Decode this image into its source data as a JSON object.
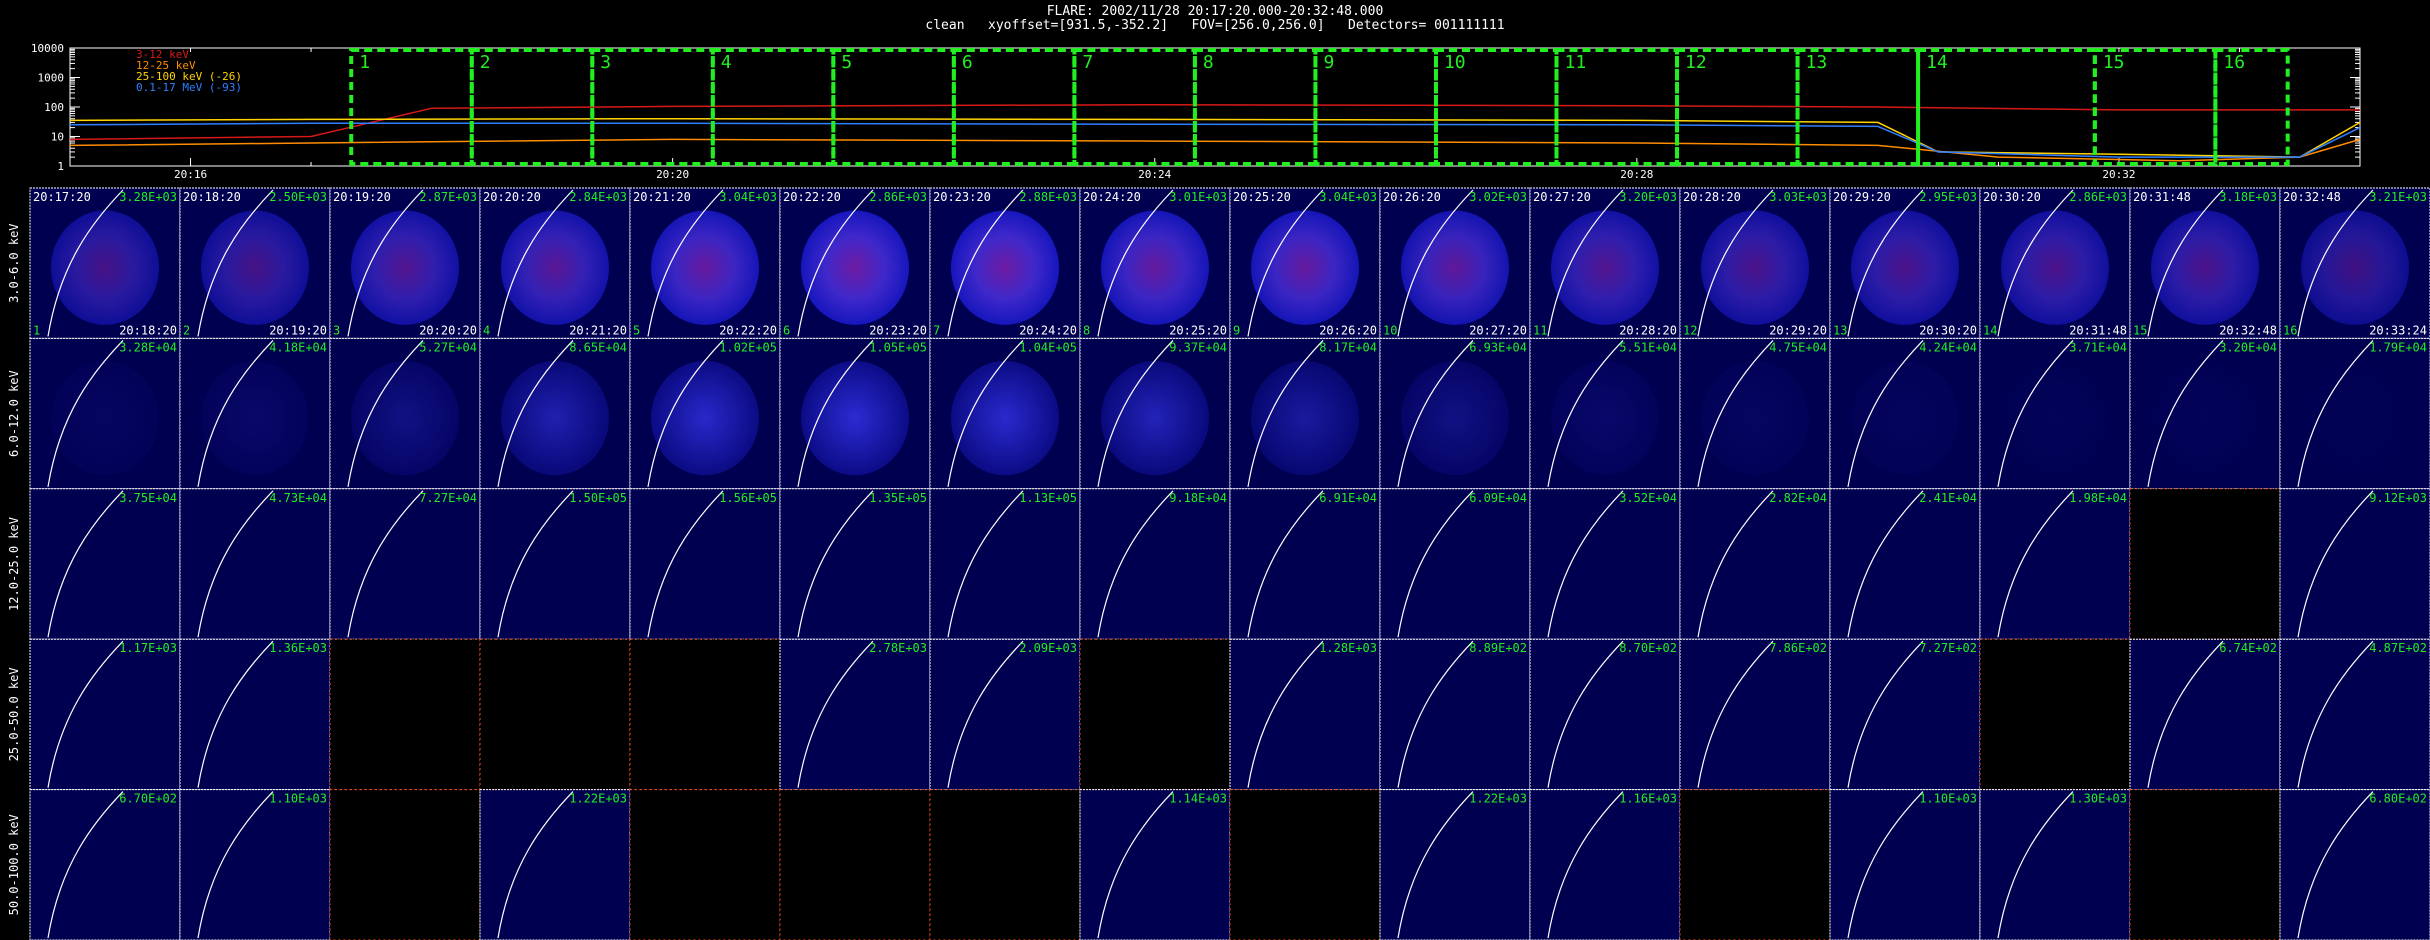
{
  "header": {
    "title": "FLARE: 2002/11/28 20:17:20.000-20:32:48.000",
    "subtitle": "clean   xyoffset=[931.5,-352.2]   FOV=[256.0,256.0]   Detectors= 001111111"
  },
  "lightcurve": {
    "legend": [
      {
        "label": "3-12 keV",
        "color": "#d81818"
      },
      {
        "label": "12-25 keV",
        "color": "#ff8c00"
      },
      {
        "label": "25-100 keV (-26)",
        "color": "#ffd400"
      },
      {
        "label": "0.1-17 MeV (-93)",
        "color": "#2f7fff"
      }
    ],
    "y_ticks": [
      "10000",
      "1000",
      "100",
      "10",
      "1"
    ],
    "x_ticks": [
      "20:16",
      "20:20",
      "20:24",
      "20:28",
      "20:32"
    ],
    "box_color": "#22ee22",
    "interval_boxes": [
      {
        "id": "1"
      },
      {
        "id": "2"
      },
      {
        "id": "3"
      },
      {
        "id": "4"
      },
      {
        "id": "5"
      },
      {
        "id": "6"
      },
      {
        "id": "7"
      },
      {
        "id": "8"
      },
      {
        "id": "9"
      },
      {
        "id": "10"
      },
      {
        "id": "11"
      },
      {
        "id": "12"
      },
      {
        "id": "13"
      },
      {
        "id": "14"
      },
      {
        "id": "15"
      },
      {
        "id": "16"
      }
    ],
    "chart_data": {
      "type": "line",
      "x_time_range": [
        "20:15:00",
        "20:34:00"
      ],
      "y_scale": "log",
      "y_range": [
        1,
        10000
      ],
      "series": [
        {
          "name": "3-12 keV",
          "t": [
            "20:15:00",
            "20:17:00",
            "20:18:00",
            "20:20:00",
            "20:24:00",
            "20:28:00",
            "20:30:00",
            "20:32:00",
            "20:34:00"
          ],
          "y": [
            8,
            10,
            90,
            105,
            120,
            110,
            100,
            80,
            80
          ]
        },
        {
          "name": "12-25 keV",
          "t": [
            "20:15:00",
            "20:17:00",
            "20:20:00",
            "20:24:00",
            "20:28:00",
            "20:30:00",
            "20:31:00",
            "20:32:30",
            "20:33:30",
            "20:34:00"
          ],
          "y": [
            5,
            6,
            8,
            7,
            6,
            5,
            2,
            1.5,
            2,
            8
          ]
        },
        {
          "name": "25-100 keV (-26)",
          "t": [
            "20:15:00",
            "20:17:00",
            "20:20:00",
            "20:24:00",
            "20:28:00",
            "20:30:00",
            "20:30:30",
            "20:32:00",
            "20:33:30",
            "20:34:00"
          ],
          "y": [
            35,
            38,
            40,
            38,
            35,
            30,
            3,
            2.5,
            2,
            30
          ]
        },
        {
          "name": "0.1-17 MeV (-93)",
          "t": [
            "20:15:00",
            "20:17:00",
            "20:20:00",
            "20:24:00",
            "20:28:00",
            "20:30:00",
            "20:30:30",
            "20:32:00",
            "20:33:30",
            "20:34:00"
          ],
          "y": [
            25,
            28,
            28,
            26,
            25,
            22,
            3,
            2,
            2,
            20
          ]
        }
      ]
    }
  },
  "image_grid": {
    "label_color": "#22ee22",
    "rows": [
      {
        "label": "3.0-6.0 keV",
        "fluxes": [
          "3.28E+03",
          "2.50E+03",
          "2.87E+03",
          "2.84E+03",
          "3.04E+03",
          "2.86E+03",
          "2.88E+03",
          "3.01E+03",
          "3.04E+03",
          "3.02E+03",
          "3.20E+03",
          "3.03E+03",
          "2.95E+03",
          "2.86E+03",
          "3.18E+03",
          "3.21E+03"
        ],
        "empty": [],
        "intensity": [
          0.55,
          0.55,
          0.65,
          0.7,
          0.8,
          0.85,
          0.85,
          0.8,
          0.8,
          0.75,
          0.65,
          0.6,
          0.6,
          0.6,
          0.6,
          0.5
        ]
      },
      {
        "label": "6.0-12.0 keV",
        "fluxes": [
          "3.28E+04",
          "4.18E+04",
          "5.27E+04",
          "8.65E+04",
          "1.02E+05",
          "1.05E+05",
          "1.04E+05",
          "9.37E+04",
          "8.17E+04",
          "6.93E+04",
          "5.51E+04",
          "4.75E+04",
          "4.24E+04",
          "3.71E+04",
          "3.20E+04",
          "1.79E+04"
        ],
        "empty": [],
        "intensity": [
          0.1,
          0.15,
          0.3,
          0.55,
          0.7,
          0.75,
          0.72,
          0.6,
          0.45,
          0.3,
          0.15,
          0.1,
          0.08,
          0.05,
          0.05,
          0.03
        ]
      },
      {
        "label": "12.0-25.0 keV",
        "fluxes": [
          "3.75E+04",
          "4.73E+04",
          "7.27E+04",
          "1.50E+05",
          "1.56E+05",
          "1.35E+05",
          "1.13E+05",
          "9.18E+04",
          "6.91E+04",
          "6.09E+04",
          "3.52E+04",
          "2.82E+04",
          "2.41E+04",
          "1.98E+04",
          "",
          "9.12E+03"
        ],
        "empty": [
          15
        ],
        "intensity": []
      },
      {
        "label": "25.0-50.0 keV",
        "fluxes": [
          "1.17E+03",
          "1.36E+03",
          "",
          "",
          "",
          "2.78E+03",
          "2.09E+03",
          "",
          "1.28E+03",
          "8.89E+02",
          "8.70E+02",
          "7.86E+02",
          "7.27E+02",
          "",
          "6.74E+02",
          "4.87E+02"
        ],
        "empty": [
          3,
          4,
          5,
          8,
          14
        ],
        "intensity": []
      },
      {
        "label": "50.0-100.0 keV",
        "fluxes": [
          "6.70E+02",
          "1.10E+03",
          "",
          "1.22E+03",
          "",
          "",
          "",
          "1.14E+03",
          "",
          "1.22E+03",
          "1.16E+03",
          "",
          "1.10E+03",
          "1.30E+03",
          "",
          "6.80E+02"
        ],
        "empty": [
          3,
          5,
          6,
          7,
          9,
          12,
          15
        ],
        "intensity": []
      }
    ],
    "time_starts": [
      "20:17:20",
      "20:18:20",
      "20:19:20",
      "20:20:20",
      "20:21:20",
      "20:22:20",
      "20:23:20",
      "20:24:20",
      "20:25:20",
      "20:26:20",
      "20:27:20",
      "20:28:20",
      "20:29:20",
      "20:30:20",
      "20:31:48",
      "20:32:48"
    ],
    "time_ends": [
      "20:18:20",
      "20:19:20",
      "20:20:20",
      "20:21:20",
      "20:22:20",
      "20:23:20",
      "20:24:20",
      "20:25:20",
      "20:26:20",
      "20:27:20",
      "20:28:20",
      "20:29:20",
      "20:30:20",
      "20:31:48",
      "20:32:48",
      "20:33:24"
    ],
    "indices": [
      "1",
      "2",
      "3",
      "4",
      "5",
      "6",
      "7",
      "8",
      "9",
      "10",
      "11",
      "12",
      "13",
      "14",
      "15",
      "16"
    ]
  }
}
